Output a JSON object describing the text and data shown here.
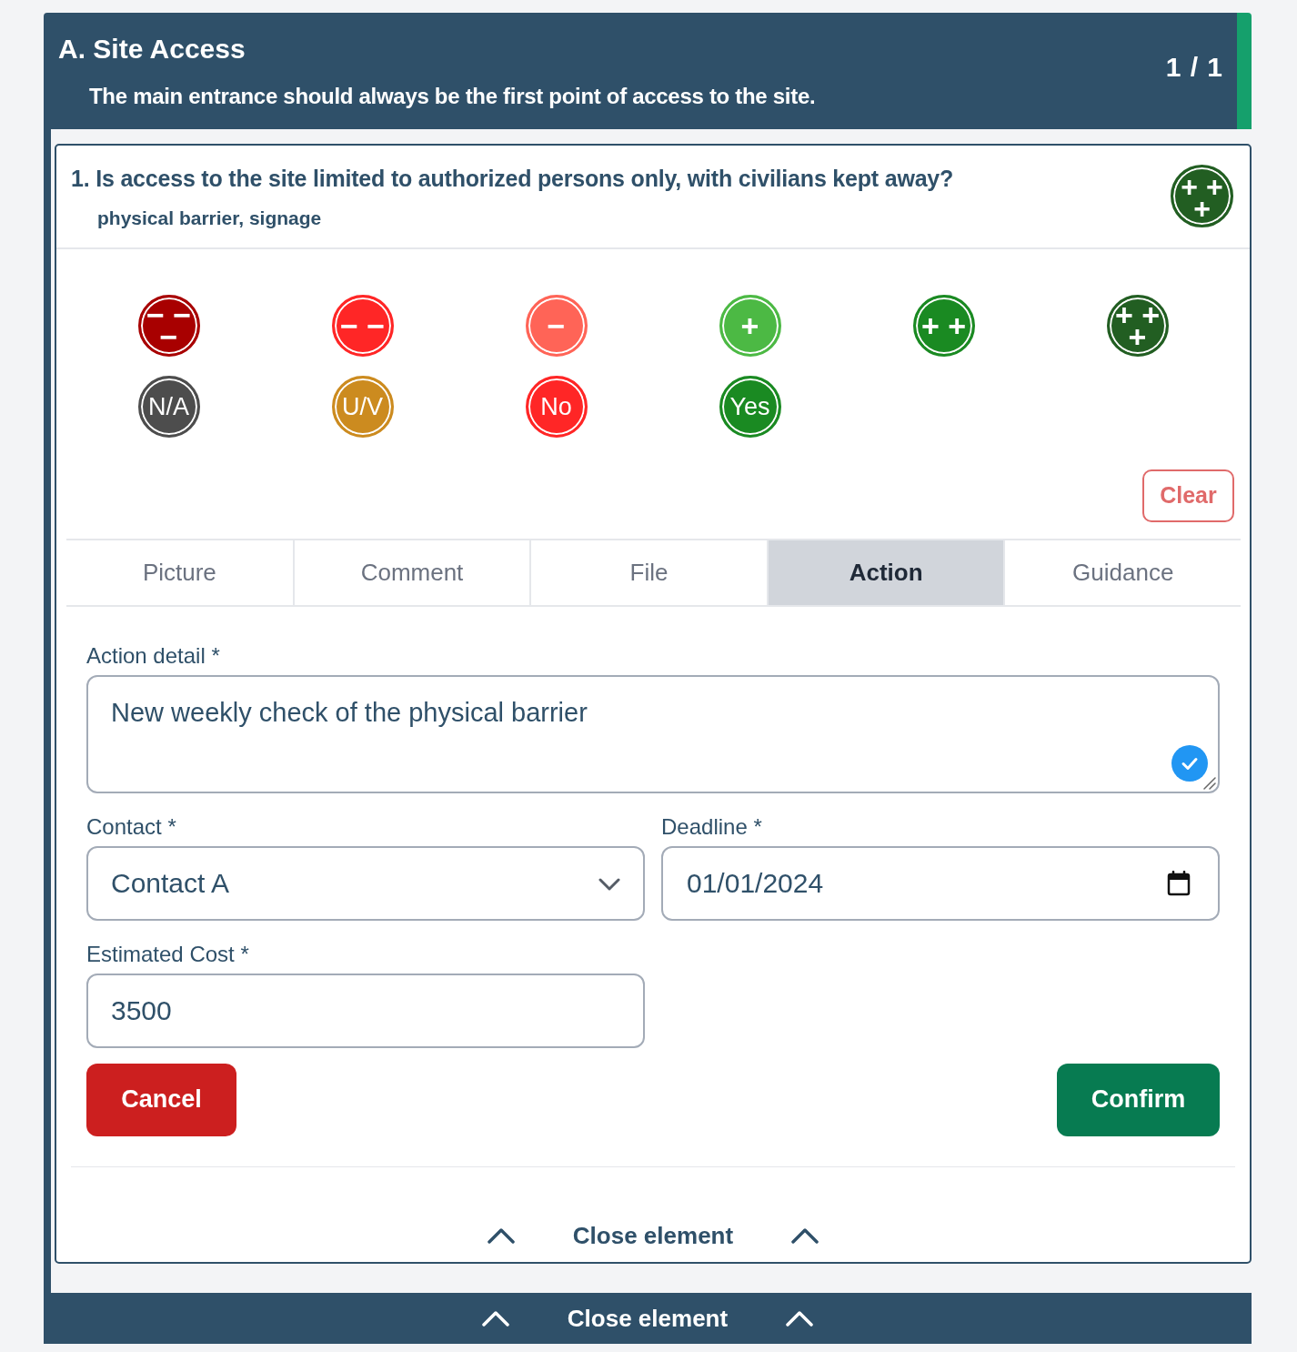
{
  "section": {
    "title": "A. Site Access",
    "subtitle": "The main entrance should always be the first point of access to the site.",
    "counter": "1 / 1"
  },
  "question": {
    "title": "1. Is access to the site limited to authorized persons only, with civilians kept away?",
    "hint": "physical barrier, signage",
    "answer": {
      "label": "+ +\n+",
      "color": "#225e22"
    }
  },
  "options": [
    {
      "kind": "symbol",
      "label": "− −\n−",
      "color": "#a80000"
    },
    {
      "kind": "symbol",
      "label": "− −",
      "color": "#ff2626"
    },
    {
      "kind": "symbol",
      "label": "−",
      "color": "#ff6457"
    },
    {
      "kind": "symbol",
      "label": "+",
      "color": "#4cb944"
    },
    {
      "kind": "symbol",
      "label": "+ +",
      "color": "#1a8a22"
    },
    {
      "kind": "symbol",
      "label": "+ +\n+",
      "color": "#225e22"
    },
    {
      "kind": "text",
      "label": "N/A",
      "color": "#4d4d4d"
    },
    {
      "kind": "text",
      "label": "U/V",
      "color": "#cc8b1f"
    },
    {
      "kind": "text",
      "label": "No",
      "color": "#ff2626"
    },
    {
      "kind": "text",
      "label": "Yes",
      "color": "#1a8a22"
    }
  ],
  "clear_button": "Clear",
  "tabs": [
    {
      "label": "Picture",
      "selected": false
    },
    {
      "label": "Comment",
      "selected": false
    },
    {
      "label": "File",
      "selected": false
    },
    {
      "label": "Action",
      "selected": true
    },
    {
      "label": "Guidance",
      "selected": false
    }
  ],
  "form": {
    "action_detail": {
      "label": "Action detail *",
      "value": "New weekly check of the physical barrier",
      "valid": true
    },
    "contact": {
      "label": "Contact *",
      "value": "Contact A"
    },
    "deadline": {
      "label": "Deadline *",
      "value": "01/01/2024"
    },
    "estimated_cost": {
      "label": "Estimated Cost *",
      "value": "3500"
    }
  },
  "buttons": [
    {
      "kind": "cancel",
      "label": "Cancel"
    },
    {
      "kind": "confirm",
      "label": "Confirm"
    }
  ],
  "card_footer": {
    "label": "Close element"
  },
  "section_footer": {
    "label": "Close element"
  }
}
